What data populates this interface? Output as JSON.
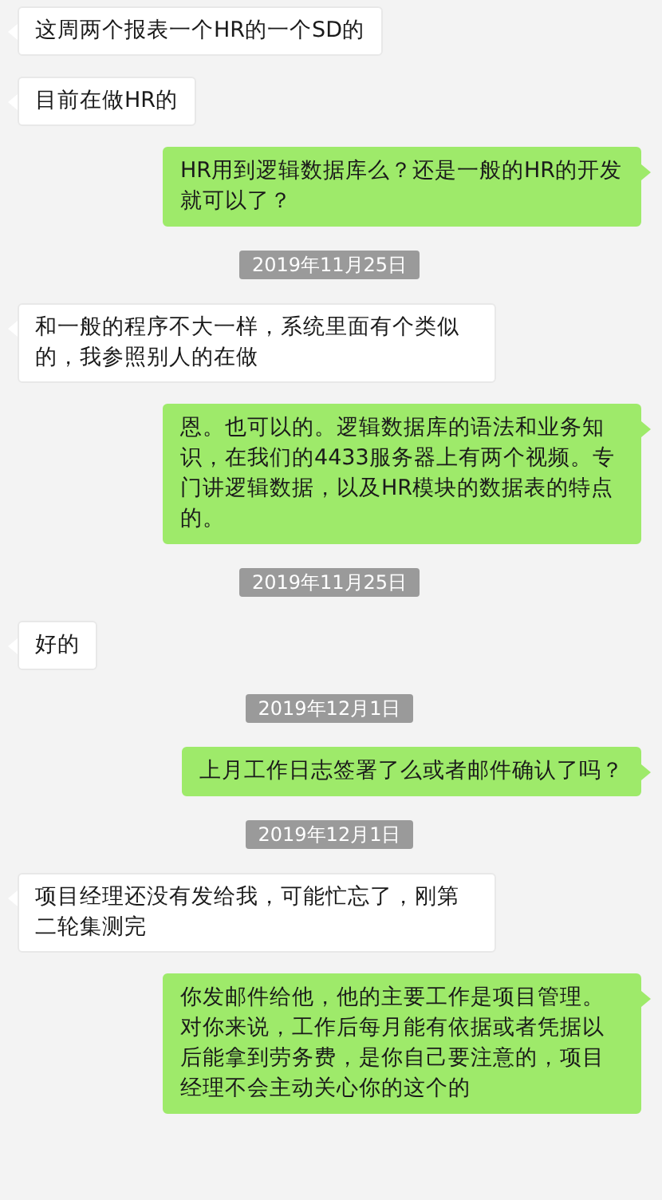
{
  "messages": [
    {
      "kind": "incoming",
      "text": "这周两个报表一个HR的一个SD的"
    },
    {
      "kind": "incoming",
      "text": "目前在做HR的"
    },
    {
      "kind": "outgoing",
      "text": "HR用到逻辑数据库么？还是一般的HR的开发就可以了？"
    },
    {
      "kind": "timestamp",
      "text": "2019年11月25日"
    },
    {
      "kind": "incoming",
      "text": "和一般的程序不大一样，系统里面有个类似的，我参照别人的在做"
    },
    {
      "kind": "outgoing",
      "text": "恩。也可以的。逻辑数据库的语法和业务知识，在我们的4433服务器上有两个视频。专门讲逻辑数据，以及HR模块的数据表的特点的。"
    },
    {
      "kind": "timestamp",
      "text": "2019年11月25日"
    },
    {
      "kind": "incoming",
      "text": "好的"
    },
    {
      "kind": "timestamp",
      "text": "2019年12月1日"
    },
    {
      "kind": "outgoing",
      "text": "上月工作日志签署了么或者邮件确认了吗？"
    },
    {
      "kind": "timestamp",
      "text": "2019年12月1日"
    },
    {
      "kind": "incoming",
      "text": "项目经理还没有发给我，可能忙忘了，刚第二轮集测完"
    },
    {
      "kind": "outgoing",
      "text": "你发邮件给他，他的主要工作是项目管理。对你来说，工作后每月能有依据或者凭据以后能拿到劳务费，是你自己要注意的，项目经理不会主动关心你的这个的"
    }
  ]
}
